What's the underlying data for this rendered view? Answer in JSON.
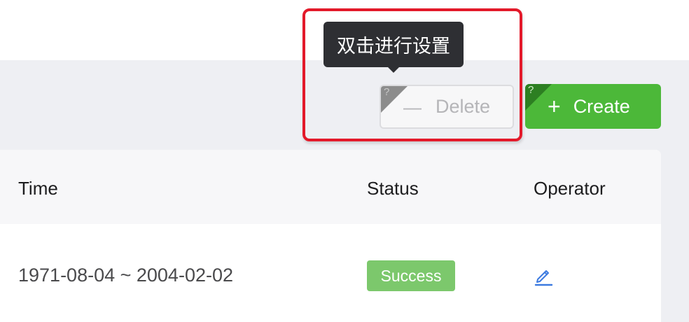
{
  "tooltip": {
    "text": "双击进行设置"
  },
  "toolbar": {
    "delete": {
      "label": "Delete",
      "icon": "minus-icon",
      "icon_glyph": "—",
      "corner_mark": "?"
    },
    "create": {
      "label": "Create",
      "icon": "plus-icon",
      "icon_glyph": "+",
      "corner_mark": "?"
    }
  },
  "table": {
    "columns": [
      "Time",
      "Status",
      "Operator"
    ],
    "rows": [
      {
        "time": "1971-08-04 ~ 2004-02-02",
        "status": "Success",
        "operator_icon": "edit-icon"
      }
    ]
  },
  "colors": {
    "create_green": "#4cb839",
    "success_green": "#7cc86c",
    "highlight_red": "#e3192a",
    "link_blue": "#3d7be0",
    "tooltip_bg": "#2e2f33",
    "band_grey": "#eeeff3"
  }
}
